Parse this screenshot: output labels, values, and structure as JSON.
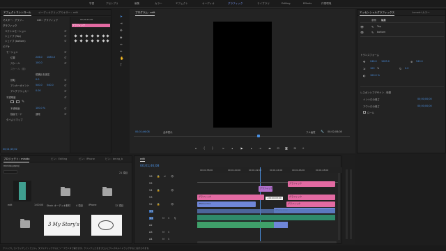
{
  "menu": {
    "workspaces": [
      "学習",
      "アセンブリ",
      "編集",
      "カラー",
      "エフェクト",
      "オーディオ",
      "グラフィック",
      "ライブラリ",
      "Editing",
      "Effects",
      "作業環境"
    ],
    "active_index": 6
  },
  "effect_controls": {
    "tabs": [
      "エフェクトコントロール",
      "オーディオクリップミキサー：edit"
    ],
    "master_label": "マスター：グラフ...",
    "source_label": "edit：グラフィック",
    "header_text": "グラフィック",
    "rows": [
      {
        "label": "ベクトルモーション",
        "value": ""
      },
      {
        "label": "シェイプ (Top)",
        "value": ""
      },
      {
        "label": "シェイプ (bottom)",
        "value": ""
      },
      {
        "label": "ビデオ",
        "value": ""
      },
      {
        "label": "モーション",
        "value": ""
      },
      {
        "label": "位置",
        "value": "246.0"
      },
      {
        "label": "スケール",
        "value": "100.0"
      },
      {
        "label": "スケール（横）",
        "value": ""
      },
      {
        "label": "縦横比を固定",
        "value": ""
      },
      {
        "label": "回転",
        "value": "0.0"
      },
      {
        "label": "アンカーポイント",
        "value": "540.0"
      },
      {
        "label": "アンチフリッカー",
        "value": "0.00"
      },
      {
        "label": "不透明度",
        "value": ""
      },
      {
        "label": "不透明度",
        "value": "100.0 %"
      },
      {
        "label": "描画モード",
        "value": "通常"
      },
      {
        "label": "タイムリマップ",
        "value": ""
      }
    ],
    "second_values": [
      "1083.0",
      "",
      "",
      "",
      "",
      "",
      "",
      "",
      "",
      "540.0"
    ],
    "ruler_label": "00;00;12;00",
    "footer_time": "00;01;45;02",
    "clip_label": "グラフィック"
  },
  "program": {
    "tab": "プログラム：edit",
    "timecode_left": "00;01;46;08",
    "fit": "全体表示",
    "quality": "フル画質",
    "timecode_right": "00;02;08;08"
  },
  "transport": {
    "buttons": [
      "marker-in",
      "marker-out",
      "mark-in",
      "mark-out",
      "go-to-in",
      "step-back",
      "play",
      "step-forward",
      "go-to-out",
      "lift",
      "extract",
      "export-frame",
      "comparison",
      "settings"
    ]
  },
  "essential_graphics": {
    "tabs": [
      "エッセンシャルグラフィックス",
      "Lumetri カラー"
    ],
    "subtabs": [
      "参照",
      "編集"
    ],
    "layers": [
      "Top",
      "bottom"
    ],
    "transform_label": "トランスフォーム",
    "transform_values": [
      "246.0",
      "1083.0",
      "100",
      "540.0",
      "0.0"
    ],
    "responsive_label": "レスポンシブデザイン - 時間",
    "intro_label": "イントロの長さ",
    "intro_value": "00;00;00;00",
    "outro_label": "アウトロの長さ",
    "outro_value": "00;00;00;00",
    "roll_label": "ロール"
  },
  "project": {
    "tabs": [
      "プロジェクト：minido",
      "ビン：Editing",
      "ビン：iPhone",
      "ビン：bmng_b"
    ],
    "path": "minido.prproj",
    "count": "21 項目",
    "items": [
      {
        "name": "edit",
        "meta": "1:00:00"
      },
      {
        "name": "Stock オーディオ素材",
        "meta": "4 項目"
      },
      {
        "name": "iPhone",
        "meta": "12 項目"
      },
      {
        "name": "",
        "meta": ""
      },
      {
        "name": "",
        "meta": ""
      },
      {
        "name": "",
        "meta": ""
      }
    ],
    "handwriting": [
      "3 My Story's",
      ""
    ]
  },
  "timeline": {
    "tab": "edit",
    "timecode": "00;01;46;08",
    "ruler": [
      "00;01;38;00",
      "00;01;40;00",
      "00;01;42;00",
      "00;01;44;00",
      "00;01;46;00",
      "00;01;48;00",
      "00;01;50;00"
    ],
    "tracks": [
      "V6",
      "V5",
      "V4",
      "V3",
      "V2",
      "V1",
      "A1",
      "A2",
      "A3",
      "A4"
    ],
    "clips": [
      "グラフィック",
      "グラフィック",
      "グラフィック",
      "グラフィック",
      "グラフィック",
      "iPhone.mov",
      "iPhone.mov"
    ],
    "drag_tooltip": "+00;00;03;09"
  },
  "status": {
    "message": "クリックしてドラッグしてください。ダブルクリックするとソースモニタで開きます。クリックしたままプロジェクトパネルへドラッグすると表示されます。"
  },
  "colors": {
    "accent": "#4a90e2",
    "pink_clip": "#e36aa2",
    "purple_clip": "#b070cc",
    "blue_clip": "#6f86d8",
    "green_audio": "#3fa06a",
    "teal_audio": "#2f8a6a"
  }
}
